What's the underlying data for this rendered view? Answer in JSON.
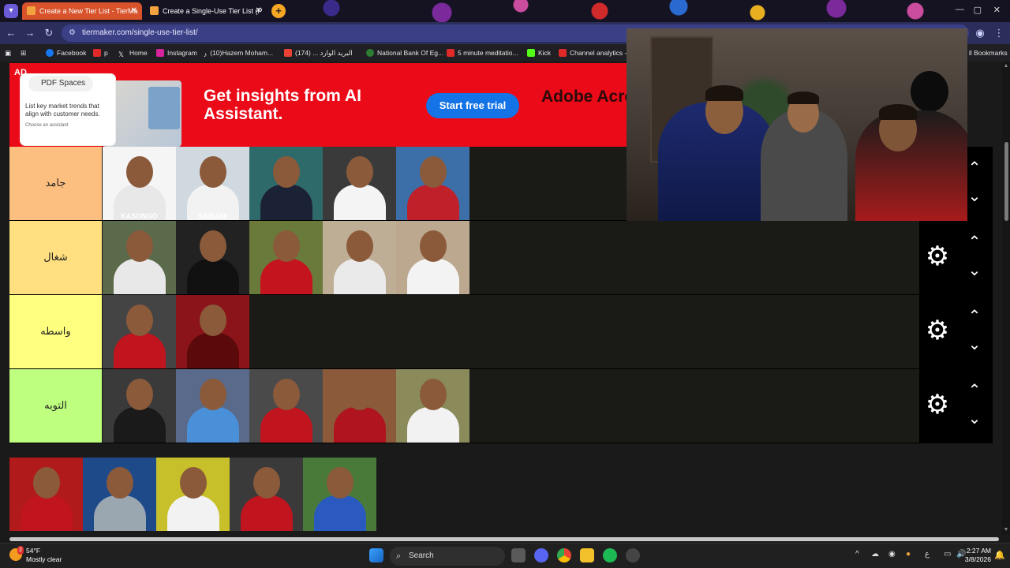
{
  "browser": {
    "tabs": [
      {
        "title": "Create a New Tier List - TierMa",
        "active": true
      },
      {
        "title": "Create a Single-Use Tier List (P",
        "active": false
      }
    ],
    "address": "tiermaker.com/single-use-tier-list/",
    "bookmarks": [
      {
        "label": "Facebook",
        "color": "#1877f2"
      },
      {
        "label": "p",
        "color": "#e02a2a"
      },
      {
        "label": "Home",
        "color": "#ffffff"
      },
      {
        "label": "Instagram",
        "color": "#d6249f"
      },
      {
        "label": "(10)Hazem Moham...",
        "color": "#ffffff"
      },
      {
        "label": "(174) ... البريد الوارد",
        "color": "#ea4335"
      },
      {
        "label": "National Bank Of Eg...",
        "color": "#2e7d32"
      },
      {
        "label": "5 minute meditatio...",
        "color": "#e02a2a"
      },
      {
        "label": "Kick",
        "color": "#53fc18"
      },
      {
        "label": "Channel analytics -...",
        "color": "#e02a2a"
      },
      {
        "label": "ll Bookmarks",
        "color": "#1f1f24"
      }
    ]
  },
  "ad": {
    "badge": "AD",
    "pill": "PDF Spaces",
    "card_text": "List key market trends that align with customer needs.",
    "card_sub": "Choose an assistant",
    "headline": "Get insights from AI Assistant.",
    "cta": "Start free trial",
    "brand": "Adobe Acrobat St"
  },
  "tiers": [
    {
      "label": "جامد",
      "color": "#fdbf7f",
      "items": [
        {
          "body": "#e8e8e8",
          "caption": "KASONGO",
          "bg": "#f5f5f5"
        },
        {
          "body": "#f2f2f2",
          "caption": "SAIBANI",
          "bg": "#d0d8e0"
        },
        {
          "body": "#1c2236",
          "caption": "",
          "bg": "#2f6a6a"
        },
        {
          "body": "#f4f4f4",
          "caption": "",
          "bg": "#3a3a3a"
        },
        {
          "body": "#c0202a",
          "caption": "",
          "bg": "#3c6fa8"
        }
      ]
    },
    {
      "label": "شغال",
      "color": "#ffdf7f",
      "items": [
        {
          "body": "#e8e8e8",
          "caption": "",
          "bg": "#5a6a4a"
        },
        {
          "body": "#111111",
          "caption": "",
          "bg": "#222222"
        },
        {
          "body": "#c4141e",
          "caption": "",
          "bg": "#6a7a3a"
        },
        {
          "body": "#eaeaea",
          "caption": "",
          "bg": "#bfae96"
        },
        {
          "body": "#f3f3f3",
          "caption": "",
          "bg": "#bca88e"
        }
      ]
    },
    {
      "label": "واسطه",
      "color": "#ffff7f",
      "items": [
        {
          "body": "#c0141e",
          "caption": "",
          "bg": "#444444"
        },
        {
          "body": "#5a0a0a",
          "caption": "",
          "bg": "#8a141a"
        }
      ]
    },
    {
      "label": "التوبه",
      "color": "#bfff7f",
      "items": [
        {
          "body": "#1a1a1a",
          "caption": "",
          "bg": "#3a3a3a"
        },
        {
          "body": "#4a90d9",
          "caption": "",
          "bg": "#5a6a8a"
        },
        {
          "body": "#c0141e",
          "caption": "",
          "bg": "#4a4a4a"
        },
        {
          "body": "#b0141e",
          "caption": "",
          "bg": "#8a5a3a"
        },
        {
          "body": "#f2f2f2",
          "caption": "",
          "bg": "#8a8a5a"
        }
      ]
    }
  ],
  "pool": [
    {
      "body": "#c0141e",
      "bg": "#b01a1a"
    },
    {
      "body": "#9aa6b0",
      "bg": "#1f4a8a"
    },
    {
      "body": "#f2f2f2",
      "bg": "#c8c02a"
    },
    {
      "body": "#c0141e",
      "bg": "#3a3a3a"
    },
    {
      "body": "#2a5ac0",
      "bg": "#4a7a3a"
    }
  ],
  "taskbar": {
    "weather_temp": "54°F",
    "weather_desc": "Mostly clear",
    "weather_badge": "2",
    "search": "Search",
    "time": "2:27 AM",
    "date": "3/8/2026",
    "lang": "ع"
  }
}
